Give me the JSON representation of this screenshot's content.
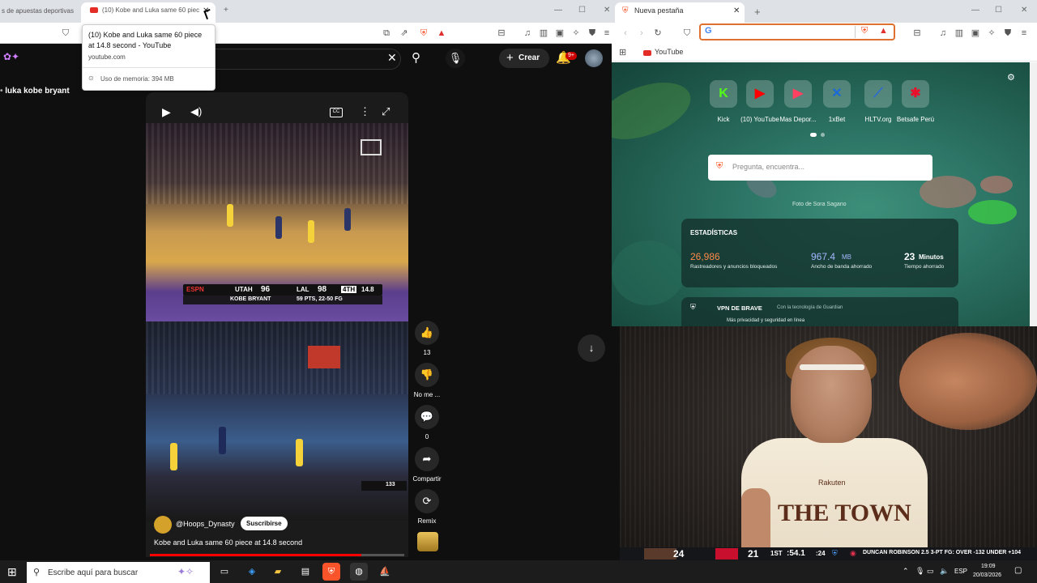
{
  "left_browser": {
    "inactive_tab_title": "s de apuestas deportivas",
    "active_tab_title": "(10) Kobe and Luka same 60 piec",
    "tooltip": {
      "title": "(10) Kobe and Luka same 60 piece at 14.8 second - YouTube",
      "url": "youtube.com",
      "memory": "Uso de memoria: 394 MB"
    }
  },
  "youtube": {
    "search_text": "luka kobe bryant",
    "create_label": "Crear",
    "notification_count": "9+",
    "video": {
      "channel": "@Hoops_Dynasty",
      "subscribe_label": "Suscribirse",
      "title": "Kobe and Luka same 60 piece at 14.8 second",
      "progress": 0.83,
      "score1": {
        "team1": "UTAH",
        "score1": "96",
        "team2": "LAL",
        "score2": "98",
        "quarter": "4TH",
        "clock": "14.8",
        "player_line": "KOBE BRYANT",
        "stat_line": "59 PTS, 22-50 FG"
      },
      "score2": {
        "value": "133"
      }
    },
    "actions": {
      "likes": "13",
      "dislike_label": "No me ...",
      "comments": "0",
      "share_label": "Compartir",
      "remix_label": "Remix"
    }
  },
  "right_browser": {
    "tab_title": "Nueva pestaña",
    "bookmark": "YouTube",
    "tiles": [
      {
        "label": "Kick",
        "glyph": "K",
        "color": "#53fc18"
      },
      {
        "label": "(10) YouTube",
        "glyph": "▶",
        "color": "#ff0000"
      },
      {
        "label": "Mas Depor...",
        "glyph": "▶",
        "color": "#ff4060"
      },
      {
        "label": "1xBet",
        "glyph": "✕",
        "color": "#1a6ad8"
      },
      {
        "label": "HLTV.org",
        "glyph": "⟋",
        "color": "#2a6ad8"
      },
      {
        "label": "Betsafe Perú",
        "glyph": "✱",
        "color": "#e8102a"
      }
    ],
    "search_placeholder": "Pregunta, encuentra...",
    "photo_credit": "Foto de Sora Sagano",
    "stats": {
      "title": "ESTADÍSTICAS",
      "trackers_value": "26,986",
      "trackers_label": "Rastreadores y anuncios bloqueados",
      "bandwidth_value": "967.4",
      "bandwidth_unit": "MB",
      "bandwidth_label": "Ancho de banda ahorrado",
      "time_value": "23",
      "time_unit": "Minutos",
      "time_label": "Tiempo ahorrado"
    },
    "vpn": {
      "title": "VPN DE BRAVE",
      "subtitle": "Con la tecnología de Guardian",
      "description": "Más privacidad y seguridad en línea"
    }
  },
  "stream": {
    "jersey_sponsor": "Rakuten",
    "jersey_text": "THE TOWN",
    "scorebug": {
      "away_score": "24",
      "home_score": "21",
      "period": "1ST",
      "clock": ":54.1",
      "shot_clock": ":24",
      "ticker": "DUNCAN ROBINSON  2.5 3-PT FG: OVER -132 UNDER +104"
    }
  },
  "taskbar": {
    "search_placeholder": "Escribe aquí para buscar",
    "language": "ESP",
    "time": "19:09",
    "date": "20/03/2026"
  }
}
